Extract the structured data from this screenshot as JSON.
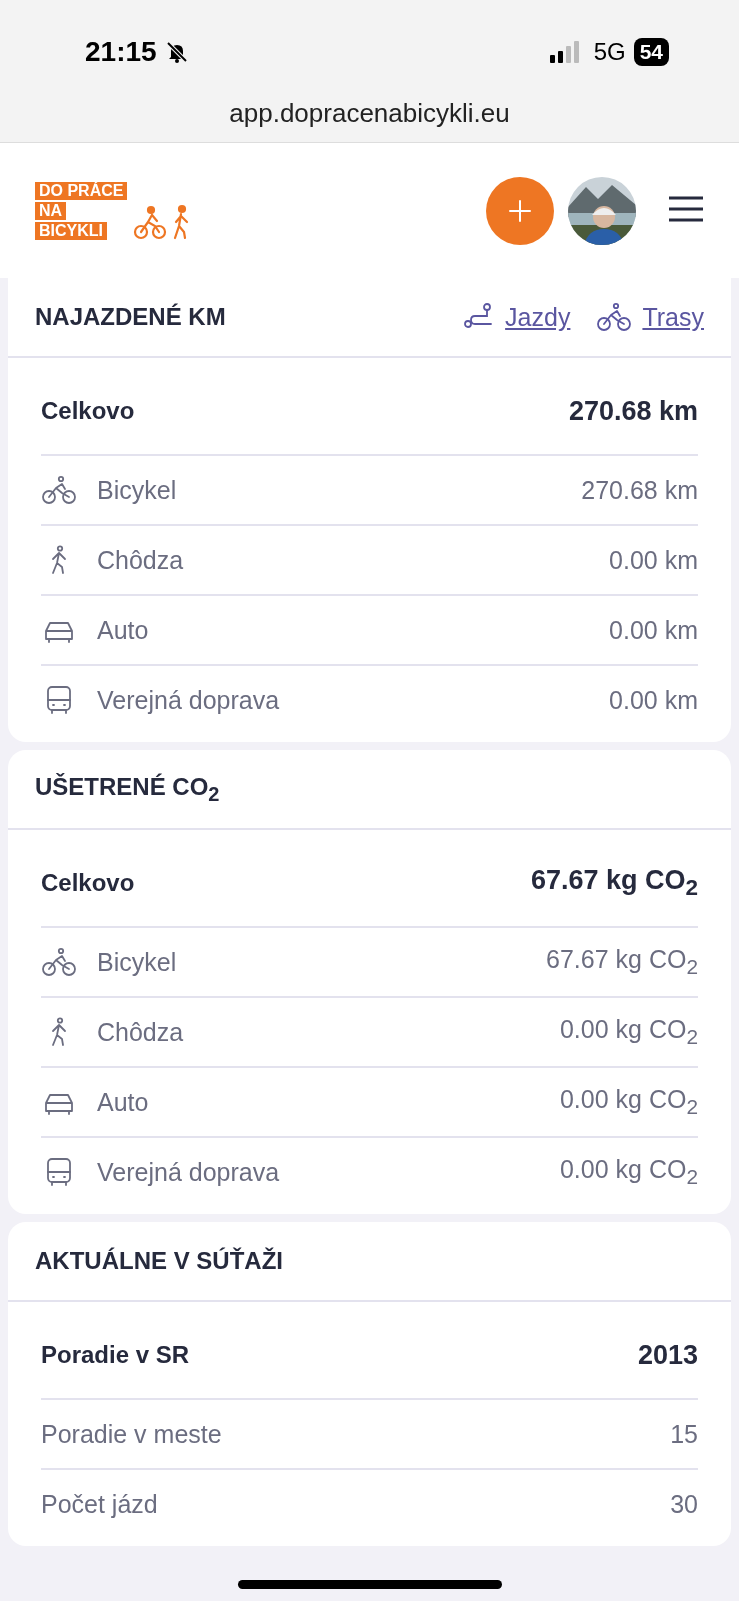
{
  "status_bar": {
    "time": "21:15",
    "network": "5G",
    "battery": "54"
  },
  "browser": {
    "url": "app.dopracenabicykli.eu"
  },
  "header": {
    "logo": [
      "DO PRÁCE",
      "NA",
      "BICYKLI"
    ]
  },
  "sections": [
    {
      "title": "NAJAZDENÉ KM",
      "links": [
        {
          "label": "Jazdy",
          "kind": "route"
        },
        {
          "label": "Trasy",
          "kind": "bike"
        }
      ],
      "rows": [
        {
          "kind": "total",
          "label": "Celkovo",
          "value": "270.68 km"
        },
        {
          "kind": "bike",
          "label": "Bicykel",
          "value": "270.68 km"
        },
        {
          "kind": "walk",
          "label": "Chôdza",
          "value": "0.00 km"
        },
        {
          "kind": "car",
          "label": "Auto",
          "value": "0.00 km"
        },
        {
          "kind": "bus",
          "label": "Verejná doprava",
          "value": "0.00 km"
        }
      ]
    },
    {
      "title": "UŠETRENÉ CO$_{2}$",
      "rows": [
        {
          "kind": "total",
          "label": "Celkovo",
          "value": "67.67 kg CO$_{2}$"
        },
        {
          "kind": "bike",
          "label": "Bicykel",
          "value": "67.67 kg CO$_{2}$"
        },
        {
          "kind": "walk",
          "label": "Chôdza",
          "value": "0.00 kg CO$_{2}$"
        },
        {
          "kind": "car",
          "label": "Auto",
          "value": "0.00 kg CO$_{2}$"
        },
        {
          "kind": "bus",
          "label": "Verejná doprava",
          "value": "0.00 kg CO$_{2}$"
        }
      ]
    },
    {
      "title": "AKTUÁLNE V SÚŤAŽI",
      "rows": [
        {
          "kind": "total",
          "label": "Poradie v SR",
          "value": "2013"
        },
        {
          "kind": "plain",
          "label": "Poradie v meste",
          "value": "15"
        },
        {
          "kind": "plain",
          "label": "Počet jázd",
          "value": "30"
        }
      ]
    }
  ]
}
